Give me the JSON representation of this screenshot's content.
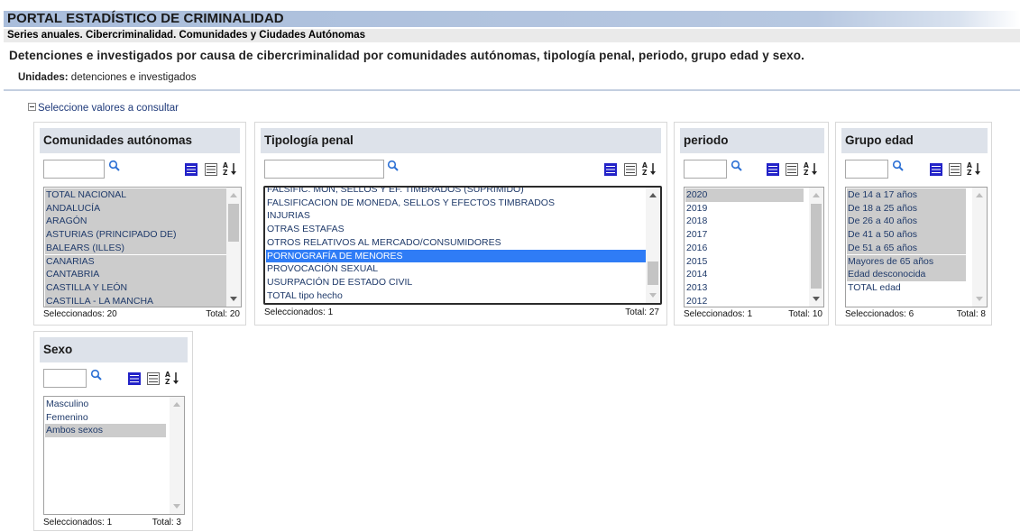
{
  "header": {
    "portal_title": "PORTAL ESTADÍSTICO DE CRIMINALIDAD",
    "series": "Series anuales. Cibercriminalidad. Comunidades y Ciudades Autónomas",
    "title": "Detenciones e investigados por causa de cibercriminalidad por comunidades autónomas, tipología penal, periodo, grupo edad y sexo.",
    "units_label": "Unidades:",
    "units_value": "detenciones e investigados"
  },
  "select_toggle": {
    "label": "Seleccione valores a consultar"
  },
  "colors": {
    "header_bar": "#b7c8e1",
    "panel_head": "#dde2ea",
    "selected_bg": "#cccccc",
    "active_bg": "#2f7cf6",
    "item_text": "#1f3a6a",
    "icon_blue": "#2323c8"
  },
  "icons": {
    "search": "magnifier-icon",
    "select_all": "select-all-icon",
    "deselect_all": "deselect-all-icon",
    "sort": "sort-az-icon"
  },
  "panels": {
    "comunidades": {
      "title": "Comunidades autónomas",
      "search_value": "",
      "items": [
        {
          "label": "TOTAL NACIONAL",
          "selected": true
        },
        {
          "label": "ANDALUCÍA",
          "selected": true
        },
        {
          "label": "ARAGÓN",
          "selected": true
        },
        {
          "label": "ASTURIAS (PRINCIPADO DE)",
          "selected": true
        },
        {
          "label": "BALEARS (ILLES)",
          "selected": true
        },
        {
          "label": "CANARIAS",
          "selected": true
        },
        {
          "label": "CANTABRIA",
          "selected": true
        },
        {
          "label": "CASTILLA Y LEÓN",
          "selected": true
        },
        {
          "label": "CASTILLA - LA MANCHA",
          "selected": true
        }
      ],
      "selected_text": "Seleccionados: 20",
      "total_text": "Total: 20"
    },
    "tipologia": {
      "title": "Tipología penal",
      "search_value": "",
      "items": [
        {
          "label": "FALSIFIC. MON, SELLOS Y EF. TIMBRADOS (SUPRIMIDO)",
          "selected": false
        },
        {
          "label": "FALSIFICACION DE MONEDA, SELLOS Y EFECTOS TIMBRADOS",
          "selected": false
        },
        {
          "label": "INJURIAS",
          "selected": false
        },
        {
          "label": "OTRAS ESTAFAS",
          "selected": false
        },
        {
          "label": "OTROS RELATIVOS AL MERCADO/CONSUMIDORES",
          "selected": false
        },
        {
          "label": "PORNOGRAFÍA DE MENORES",
          "selected": true,
          "active": true
        },
        {
          "label": "PROVOCACIÓN SEXUAL",
          "selected": false
        },
        {
          "label": "USURPACIÓN DE ESTADO CIVIL",
          "selected": false
        },
        {
          "label": "TOTAL tipo hecho",
          "selected": false
        }
      ],
      "selected_text": "Seleccionados: 1",
      "total_text": "Total: 27"
    },
    "periodo": {
      "title": "periodo",
      "search_value": "",
      "items": [
        {
          "label": "2020",
          "selected": true
        },
        {
          "label": "2019",
          "selected": false
        },
        {
          "label": "2018",
          "selected": false
        },
        {
          "label": "2017",
          "selected": false
        },
        {
          "label": "2016",
          "selected": false
        },
        {
          "label": "2015",
          "selected": false
        },
        {
          "label": "2014",
          "selected": false
        },
        {
          "label": "2013",
          "selected": false
        },
        {
          "label": "2012",
          "selected": false
        }
      ],
      "selected_text": "Seleccionados: 1",
      "total_text": "Total: 10"
    },
    "grupo_edad": {
      "title": "Grupo edad",
      "search_value": "",
      "items": [
        {
          "label": "De 14 a 17 años",
          "selected": true
        },
        {
          "label": "De 18 a 25 años",
          "selected": true
        },
        {
          "label": "De 26 a 40 años",
          "selected": true
        },
        {
          "label": "De 41 a 50 años",
          "selected": true
        },
        {
          "label": "De 51 a 65 años",
          "selected": true
        },
        {
          "label": "Mayores de 65 años",
          "selected": true
        },
        {
          "label": "Edad desconocida",
          "selected": true
        },
        {
          "label": "TOTAL edad",
          "selected": false
        }
      ],
      "selected_text": "Seleccionados: 6",
      "total_text": "Total: 8"
    },
    "sexo": {
      "title": "Sexo",
      "search_value": "",
      "items": [
        {
          "label": "Masculino",
          "selected": false
        },
        {
          "label": "Femenino",
          "selected": false
        },
        {
          "label": "Ambos sexos",
          "selected": true
        }
      ],
      "selected_text": "Seleccionados: 1",
      "total_text": "Total: 3"
    }
  }
}
